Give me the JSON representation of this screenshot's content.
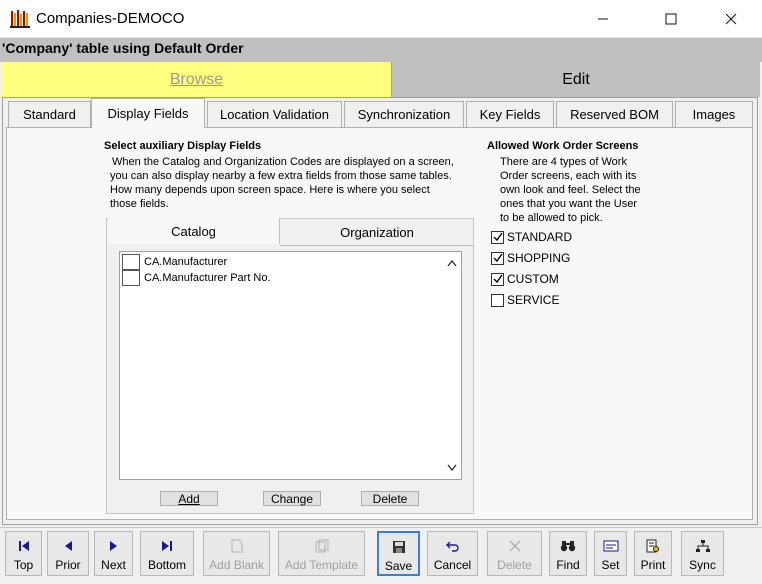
{
  "window": {
    "title": "Companies-DEMOCO"
  },
  "header": {
    "title": "'Company' table using Default Order"
  },
  "modes": {
    "browse": "Browse",
    "edit": "Edit"
  },
  "tabs": [
    "Standard",
    "Display Fields",
    "Location Validation",
    "Synchronization",
    "Key Fields",
    "Reserved BOM",
    "Images"
  ],
  "display_fields": {
    "heading": "Select auxiliary Display Fields",
    "description": [
      "When the Catalog and Organization Codes are displayed on a screen,",
      "you can also display nearby a few extra fields from those same tables.",
      "How many depends upon screen space. Here is where you select",
      "those fields."
    ],
    "subtabs": {
      "catalog": "Catalog",
      "organization": "Organization"
    },
    "items": [
      "CA.Manufacturer",
      "CA.Manufacturer Part No."
    ],
    "buttons": {
      "add": "Add",
      "change": "Change",
      "delete": "Delete"
    }
  },
  "work_orders": {
    "heading": "Allowed Work Order Screens",
    "description": [
      "There are 4 types of Work",
      "Order screens, each with its",
      "own look and feel. Select the",
      "ones that you want the User",
      "to be allowed to pick."
    ],
    "options": [
      {
        "label": "STANDARD",
        "checked": true
      },
      {
        "label": "SHOPPING",
        "checked": true
      },
      {
        "label": "CUSTOM",
        "checked": true
      },
      {
        "label": "SERVICE",
        "checked": false
      }
    ]
  },
  "toolbar": {
    "top": "Top",
    "prior": "Prior",
    "next": "Next",
    "bottom": "Bottom",
    "add_blank": "Add Blank",
    "add_template": "Add Template",
    "save": "Save",
    "cancel": "Cancel",
    "delete": "Delete",
    "find": "Find",
    "set": "Set",
    "print": "Print",
    "sync": "Sync"
  },
  "colors": {
    "browse_bg": "#ffff80",
    "header_bg": "#c0c0c0",
    "focus": "#3c7fd6"
  }
}
